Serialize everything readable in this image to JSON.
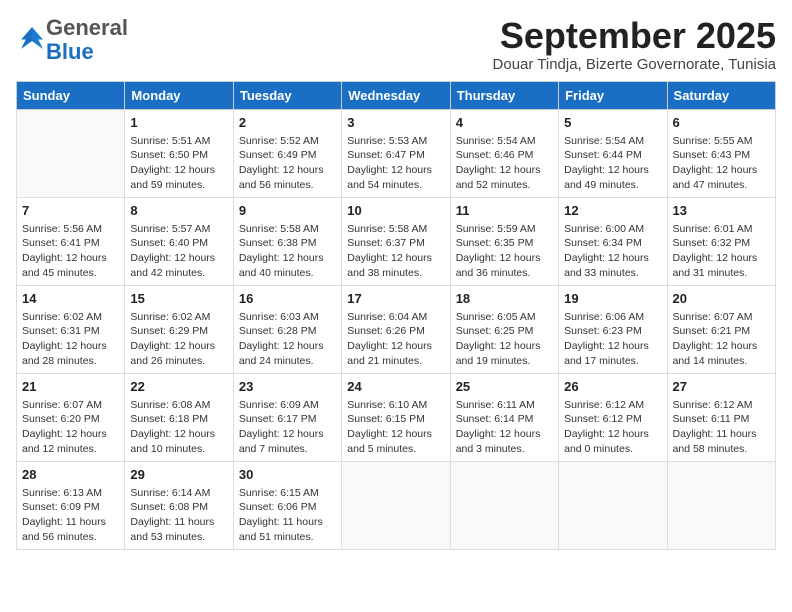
{
  "logo": {
    "general": "General",
    "blue": "Blue"
  },
  "header": {
    "month": "September 2025",
    "location": "Douar Tindja, Bizerte Governorate, Tunisia"
  },
  "weekdays": [
    "Sunday",
    "Monday",
    "Tuesday",
    "Wednesday",
    "Thursday",
    "Friday",
    "Saturday"
  ],
  "weeks": [
    [
      {
        "day": "",
        "text": ""
      },
      {
        "day": "1",
        "text": "Sunrise: 5:51 AM\nSunset: 6:50 PM\nDaylight: 12 hours\nand 59 minutes."
      },
      {
        "day": "2",
        "text": "Sunrise: 5:52 AM\nSunset: 6:49 PM\nDaylight: 12 hours\nand 56 minutes."
      },
      {
        "day": "3",
        "text": "Sunrise: 5:53 AM\nSunset: 6:47 PM\nDaylight: 12 hours\nand 54 minutes."
      },
      {
        "day": "4",
        "text": "Sunrise: 5:54 AM\nSunset: 6:46 PM\nDaylight: 12 hours\nand 52 minutes."
      },
      {
        "day": "5",
        "text": "Sunrise: 5:54 AM\nSunset: 6:44 PM\nDaylight: 12 hours\nand 49 minutes."
      },
      {
        "day": "6",
        "text": "Sunrise: 5:55 AM\nSunset: 6:43 PM\nDaylight: 12 hours\nand 47 minutes."
      }
    ],
    [
      {
        "day": "7",
        "text": "Sunrise: 5:56 AM\nSunset: 6:41 PM\nDaylight: 12 hours\nand 45 minutes."
      },
      {
        "day": "8",
        "text": "Sunrise: 5:57 AM\nSunset: 6:40 PM\nDaylight: 12 hours\nand 42 minutes."
      },
      {
        "day": "9",
        "text": "Sunrise: 5:58 AM\nSunset: 6:38 PM\nDaylight: 12 hours\nand 40 minutes."
      },
      {
        "day": "10",
        "text": "Sunrise: 5:58 AM\nSunset: 6:37 PM\nDaylight: 12 hours\nand 38 minutes."
      },
      {
        "day": "11",
        "text": "Sunrise: 5:59 AM\nSunset: 6:35 PM\nDaylight: 12 hours\nand 36 minutes."
      },
      {
        "day": "12",
        "text": "Sunrise: 6:00 AM\nSunset: 6:34 PM\nDaylight: 12 hours\nand 33 minutes."
      },
      {
        "day": "13",
        "text": "Sunrise: 6:01 AM\nSunset: 6:32 PM\nDaylight: 12 hours\nand 31 minutes."
      }
    ],
    [
      {
        "day": "14",
        "text": "Sunrise: 6:02 AM\nSunset: 6:31 PM\nDaylight: 12 hours\nand 28 minutes."
      },
      {
        "day": "15",
        "text": "Sunrise: 6:02 AM\nSunset: 6:29 PM\nDaylight: 12 hours\nand 26 minutes."
      },
      {
        "day": "16",
        "text": "Sunrise: 6:03 AM\nSunset: 6:28 PM\nDaylight: 12 hours\nand 24 minutes."
      },
      {
        "day": "17",
        "text": "Sunrise: 6:04 AM\nSunset: 6:26 PM\nDaylight: 12 hours\nand 21 minutes."
      },
      {
        "day": "18",
        "text": "Sunrise: 6:05 AM\nSunset: 6:25 PM\nDaylight: 12 hours\nand 19 minutes."
      },
      {
        "day": "19",
        "text": "Sunrise: 6:06 AM\nSunset: 6:23 PM\nDaylight: 12 hours\nand 17 minutes."
      },
      {
        "day": "20",
        "text": "Sunrise: 6:07 AM\nSunset: 6:21 PM\nDaylight: 12 hours\nand 14 minutes."
      }
    ],
    [
      {
        "day": "21",
        "text": "Sunrise: 6:07 AM\nSunset: 6:20 PM\nDaylight: 12 hours\nand 12 minutes."
      },
      {
        "day": "22",
        "text": "Sunrise: 6:08 AM\nSunset: 6:18 PM\nDaylight: 12 hours\nand 10 minutes."
      },
      {
        "day": "23",
        "text": "Sunrise: 6:09 AM\nSunset: 6:17 PM\nDaylight: 12 hours\nand 7 minutes."
      },
      {
        "day": "24",
        "text": "Sunrise: 6:10 AM\nSunset: 6:15 PM\nDaylight: 12 hours\nand 5 minutes."
      },
      {
        "day": "25",
        "text": "Sunrise: 6:11 AM\nSunset: 6:14 PM\nDaylight: 12 hours\nand 3 minutes."
      },
      {
        "day": "26",
        "text": "Sunrise: 6:12 AM\nSunset: 6:12 PM\nDaylight: 12 hours\nand 0 minutes."
      },
      {
        "day": "27",
        "text": "Sunrise: 6:12 AM\nSunset: 6:11 PM\nDaylight: 11 hours\nand 58 minutes."
      }
    ],
    [
      {
        "day": "28",
        "text": "Sunrise: 6:13 AM\nSunset: 6:09 PM\nDaylight: 11 hours\nand 56 minutes."
      },
      {
        "day": "29",
        "text": "Sunrise: 6:14 AM\nSunset: 6:08 PM\nDaylight: 11 hours\nand 53 minutes."
      },
      {
        "day": "30",
        "text": "Sunrise: 6:15 AM\nSunset: 6:06 PM\nDaylight: 11 hours\nand 51 minutes."
      },
      {
        "day": "",
        "text": ""
      },
      {
        "day": "",
        "text": ""
      },
      {
        "day": "",
        "text": ""
      },
      {
        "day": "",
        "text": ""
      }
    ]
  ]
}
